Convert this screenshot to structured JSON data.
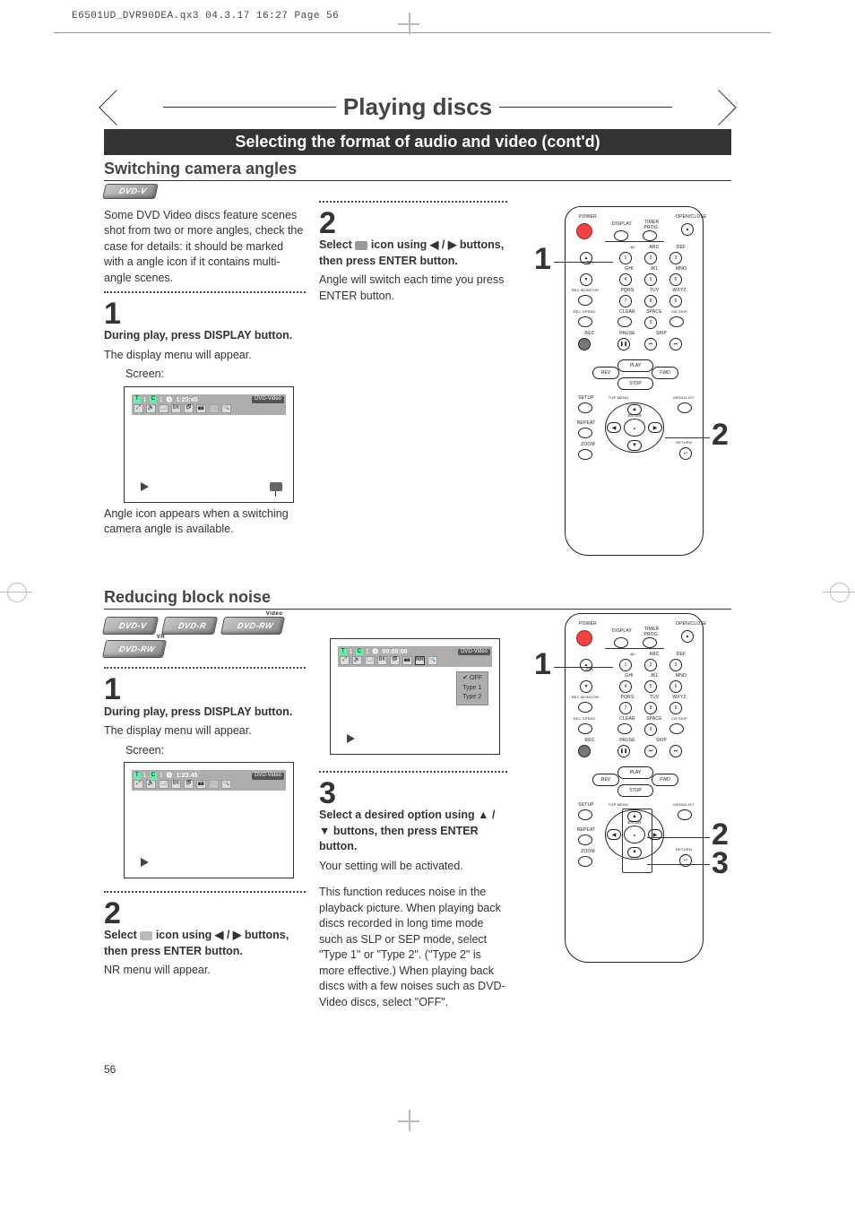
{
  "header_tag": "E6501UD_DVR90DEA.qx3  04.3.17  16:27  Page 56",
  "page_title": "Playing discs",
  "page_subtitle": "Selecting the format of audio and video (cont'd)",
  "section_a_title": "Switching camera angles",
  "section_b_title": "Reducing block noise",
  "badges": {
    "dvdv": "DVD-V",
    "dvdr": "DVD-R",
    "dvdrw_video": "DVD-RW",
    "dvdrw_vr": "DVD-RW"
  },
  "a_intro": "Some DVD Video discs feature scenes shot from two or more angles, check the case for details: it should be marked with a angle icon if it contains multi-angle scenes.",
  "a_step1_head": "During play, press DISPLAY button.",
  "a_step1_body": "The display menu will appear.",
  "a_step1_body2": "Screen:",
  "a_step1_caption": "Angle icon appears when a switching camera angle is available.",
  "a_step2_head_pre": "Select",
  "a_step2_head_post": "icon using ◀ / ▶ buttons, then press ENTER button.",
  "a_step2_body": "Angle will switch each time you press ENTER button.",
  "b_step1_head": "During play, press DISPLAY button.",
  "b_step1_body": "The display menu will appear.",
  "b_step1_body2": "Screen:",
  "b_step2_head_pre": "Select",
  "b_step2_head_post": "icon using ◀ / ▶ buttons, then press ENTER button.",
  "b_step2_body": "NR menu will appear.",
  "b_step3_head": "Select a desired option using ▲ / ▼ buttons, then press ENTER button.",
  "b_step3_body1": "Your setting will be activated.",
  "b_step3_body2": "This function reduces noise in the playback picture. When playing back discs recorded in long time mode such as SLP or SEP mode, select \"Type 1\" or \"Type 2\". (\"Type 2\" is more effective.) When playing back discs with a few noises such as DVD-Video discs, select \"OFF\".",
  "osd": {
    "badge": "DVD-Video",
    "t": "T",
    "t_val": "1",
    "c": "C",
    "c_val": "1",
    "time1": "1:23:45",
    "time2": "00:00:00",
    "row2_icons": [
      "⤢",
      "🔊",
      "🗔",
      "BK",
      "🗗",
      "📷",
      "NR",
      "🔍"
    ],
    "nr_options": [
      "OFF",
      "Type 1",
      "Type 2"
    ]
  },
  "remote": {
    "power": "POWER",
    "open": "OPEN/CLOSE",
    "display": "DISPLAY",
    "timer": "TIMER PROG.",
    "abc": "ABC",
    "def": "DEF",
    "ghi": "GHI",
    "jkl": "JKL",
    "mno": "MNO",
    "pqrs": "PQRS",
    "tuv": "TUV",
    "wxyz": "WXYZ",
    "ch": "CH",
    "rec_mon": "REC MONITOR",
    "rec_speed": "REC SPEED",
    "clear": "CLEAR",
    "space": "SPACE",
    "cmskip": "CM SKIP",
    "rec": "REC",
    "pause": "PAUSE",
    "skip": "SKIP",
    "play": "PLAY",
    "stop": "STOP",
    "rev": "REV",
    "fwd": "FWD",
    "setup": "SETUP",
    "topmenu": "TOP MENU",
    "menulist": "MENU/LIST",
    "repeat": "REPEAT",
    "zoom": "ZOOM",
    "enter": "ENTER",
    "return": "RETURN",
    "pad": {
      "n1": "1",
      "n2": "2",
      "n3": "3",
      "n4": "4",
      "n5": "5",
      "n6": "6",
      "n7": "7",
      "n8": "8",
      "n9": "9",
      "n0": "0",
      "at": ".@/:"
    }
  },
  "callouts": {
    "c1": "1",
    "c2": "2",
    "c3": "3"
  },
  "page_number": "56"
}
